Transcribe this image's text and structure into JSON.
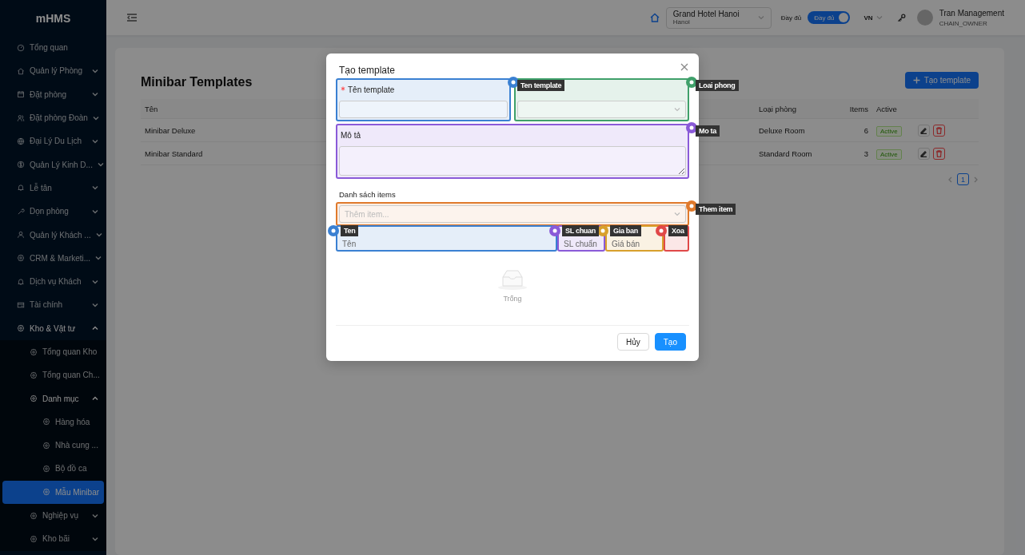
{
  "sidebar": {
    "logo": "mHMS",
    "items": [
      {
        "label": "Tổng quan"
      },
      {
        "label": "Quản lý Phòng",
        "expanded": false
      },
      {
        "label": "Đặt phòng",
        "expanded": false
      },
      {
        "label": "Đặt phòng Đoàn",
        "expanded": false
      },
      {
        "label": "Đại Lý Du Lịch",
        "expanded": false
      },
      {
        "label": "Quản Lý Kinh D...",
        "expanded": false
      },
      {
        "label": "Lễ tân",
        "expanded": false
      },
      {
        "label": "Dọn phòng",
        "expanded": false
      },
      {
        "label": "Quản lý Khách ...",
        "expanded": false
      },
      {
        "label": "CRM & Marketi...",
        "expanded": false
      },
      {
        "label": "Dịch vụ Khách",
        "expanded": false
      },
      {
        "label": "Tài chính",
        "expanded": false
      },
      {
        "label": "Kho & Vật tư",
        "expanded": true,
        "children": [
          {
            "label": "Tổng quan Kho"
          },
          {
            "label": "Tổng quan Ch..."
          },
          {
            "label": "Danh mục",
            "expanded": true,
            "children": [
              {
                "label": "Hàng hóa",
                "selected": false
              },
              {
                "label": "Nhà cung ...",
                "selected": false
              },
              {
                "label": "Bộ đồ ca",
                "selected": false
              },
              {
                "label": "Mẫu Minibar",
                "selected": true
              }
            ]
          },
          {
            "label": "Nghiệp vụ",
            "expanded": false
          },
          {
            "label": "Kho bãi",
            "expanded": false
          }
        ]
      }
    ]
  },
  "header": {
    "hotel": {
      "name": "Grand Hotel Hanoi",
      "city": "Hanoi"
    },
    "mode_label": "Đầy đủ",
    "mode_switch": {
      "label": "Đầy đủ",
      "on": true
    },
    "language": "VN",
    "user": {
      "name": "Tran Management",
      "role": "CHAIN_OWNER"
    }
  },
  "page": {
    "title": "Minibar Templates",
    "create_button": "Tạo template",
    "table": {
      "columns": [
        "Tên",
        "Loại phòng",
        "Items",
        "Active"
      ],
      "rows": [
        {
          "name": "Minibar Deluxe",
          "room_type": "Deluxe Room",
          "items": "6",
          "active": "Active"
        },
        {
          "name": "Minibar Standard",
          "room_type": "Standard Room",
          "items": "3",
          "active": "Active"
        }
      ]
    },
    "pagination": {
      "pages": [
        {
          "label": "1",
          "selected": true
        }
      ]
    }
  },
  "modal": {
    "title": "Tạo template",
    "fields": [
      {
        "label": "Tên template",
        "required": true,
        "kind": "input",
        "annotation": {
          "label": "Ten template",
          "color": "#3a80d2"
        }
      },
      {
        "kind": "select",
        "annotation": {
          "label": "Loai phong",
          "color": "#3fa06a"
        }
      },
      {
        "label": "Mô tả",
        "kind": "textarea",
        "annotation": {
          "label": "Mo ta",
          "color": "#8a5ad8"
        }
      }
    ],
    "items_section": {
      "label": "Danh sách items",
      "placeholder": "Thêm item...",
      "annotation": {
        "label": "Them item",
        "color": "#e07a2c"
      },
      "columns": [
        {
          "label": "Tên",
          "annotation": {
            "label": "Ten",
            "color": "#3a80d2"
          }
        },
        {
          "label": "SL chuẩn",
          "annotation": {
            "label": "SL chuan",
            "color": "#8a5ad8"
          }
        },
        {
          "label": "Giá bán",
          "annotation": {
            "label": "Gia ban",
            "color": "#d8a02c"
          }
        },
        {
          "annotation": {
            "label": "Xoa",
            "color": "#e04848"
          }
        }
      ],
      "empty_text": "Trống"
    },
    "buttons": [
      {
        "label": "Hủy",
        "kind": "default"
      },
      {
        "label": "Tạo",
        "kind": "primary"
      }
    ]
  }
}
